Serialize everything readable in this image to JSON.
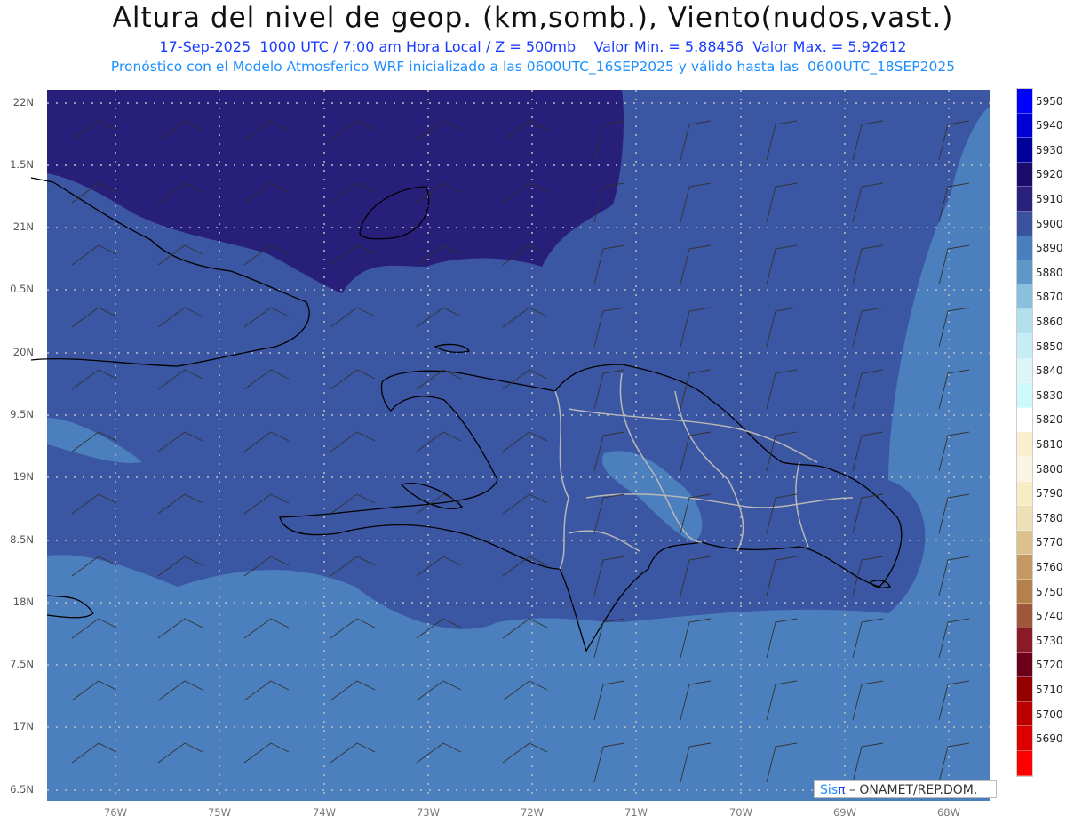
{
  "header": {
    "title": "Altura del nivel de geop. (km,somb.), Viento(nudos,vast.)",
    "subtitle": "17-Sep-2025  1000 UTC / 7:00 am Hora Local / Z = 500mb    Valor Min. = 5.88456  Valor Max. = 5.92612",
    "forecast_info": "Pronóstico con el Modelo Atmosferico WRF inicializado a las 0600UTC_16SEP2025 y válido hasta las  0600UTC_18SEP2025"
  },
  "axes": {
    "lat_labels": [
      "22N",
      "1.5N",
      "21N",
      "0.5N",
      "20N",
      "9.5N",
      "19N",
      "8.5N",
      "18N",
      "7.5N",
      "17N",
      "6.5N"
    ],
    "lon_labels": [
      "76W",
      "75W",
      "74W",
      "73W",
      "72W",
      "71W",
      "70W",
      "69W",
      "68W"
    ]
  },
  "colorbar": {
    "labels": [
      "5950",
      "5940",
      "5930",
      "5920",
      "5910",
      "5900",
      "5890",
      "5880",
      "5870",
      "5860",
      "5850",
      "5840",
      "5830",
      "5820",
      "5810",
      "5800",
      "5790",
      "5780",
      "5770",
      "5760",
      "5750",
      "5740",
      "5730",
      "5720",
      "5710",
      "5700",
      "5690"
    ],
    "colors": [
      "#0000ff",
      "#0000d6",
      "#00009a",
      "#1c0a6c",
      "#2a207e",
      "#3a539f",
      "#4a7fbd",
      "#5e98c9",
      "#8abfdd",
      "#b2e0ee",
      "#c6edf5",
      "#ddf5f9",
      "#ccf9fb",
      "#ffffff",
      "#f8f0cc",
      "#faf5e2",
      "#f6ecc6",
      "#eedfb4",
      "#dcc08e",
      "#c49862",
      "#b4804c",
      "#a0583c",
      "#8a1a28",
      "#6c0018",
      "#940000",
      "#bc0000",
      "#dc0000",
      "#ff0000"
    ]
  },
  "field_colors": {
    "dark": "#271f7a",
    "mid": "#3b56a3",
    "light": "#4b7fbd"
  },
  "credit": {
    "sis": "Sis",
    "pi": "π",
    "rest": " –  ONAMET/REP.DOM."
  }
}
